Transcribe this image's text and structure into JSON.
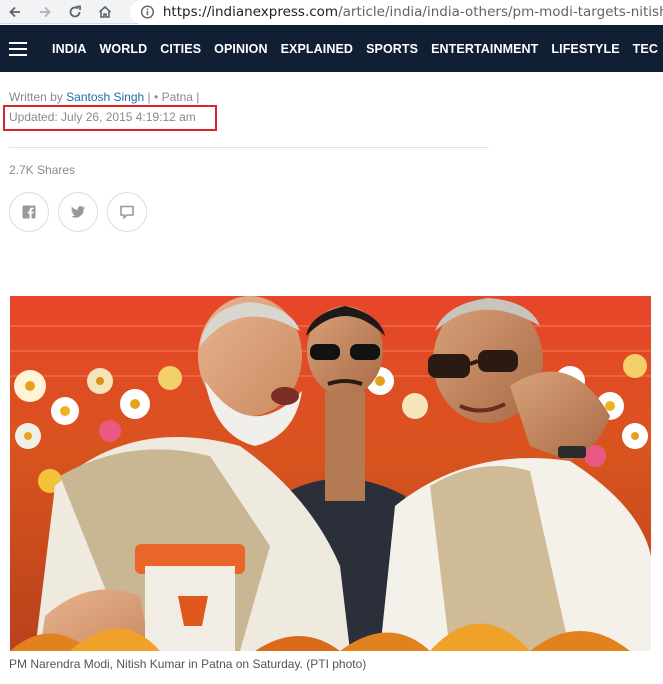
{
  "browser": {
    "url_domain": "https://indianexpress.com",
    "url_path": "/article/india/india-others/pm-modi-targets-nitish-kum"
  },
  "nav": {
    "items": [
      "INDIA",
      "WORLD",
      "CITIES",
      "OPINION",
      "EXPLAINED",
      "SPORTS",
      "ENTERTAINMENT",
      "LIFESTYLE",
      "TEC"
    ]
  },
  "article": {
    "written_by": "Written by",
    "author": "Santosh Singh",
    "sep1": "|",
    "bullet": "•",
    "location": "Patna",
    "sep2": "|",
    "updated": "Updated: July 26, 2015 4:19:12 am",
    "shares": "2.7K Shares",
    "caption": "PM Narendra Modi, Nitish Kumar in Patna on Saturday. (PTI photo)"
  },
  "colors": {
    "nav_bg": "#101f33",
    "author_link": "#1a6fa8",
    "highlight_box": "#d9242b"
  },
  "icons": {
    "share": [
      "facebook-icon",
      "twitter-icon",
      "comment-icon"
    ]
  }
}
